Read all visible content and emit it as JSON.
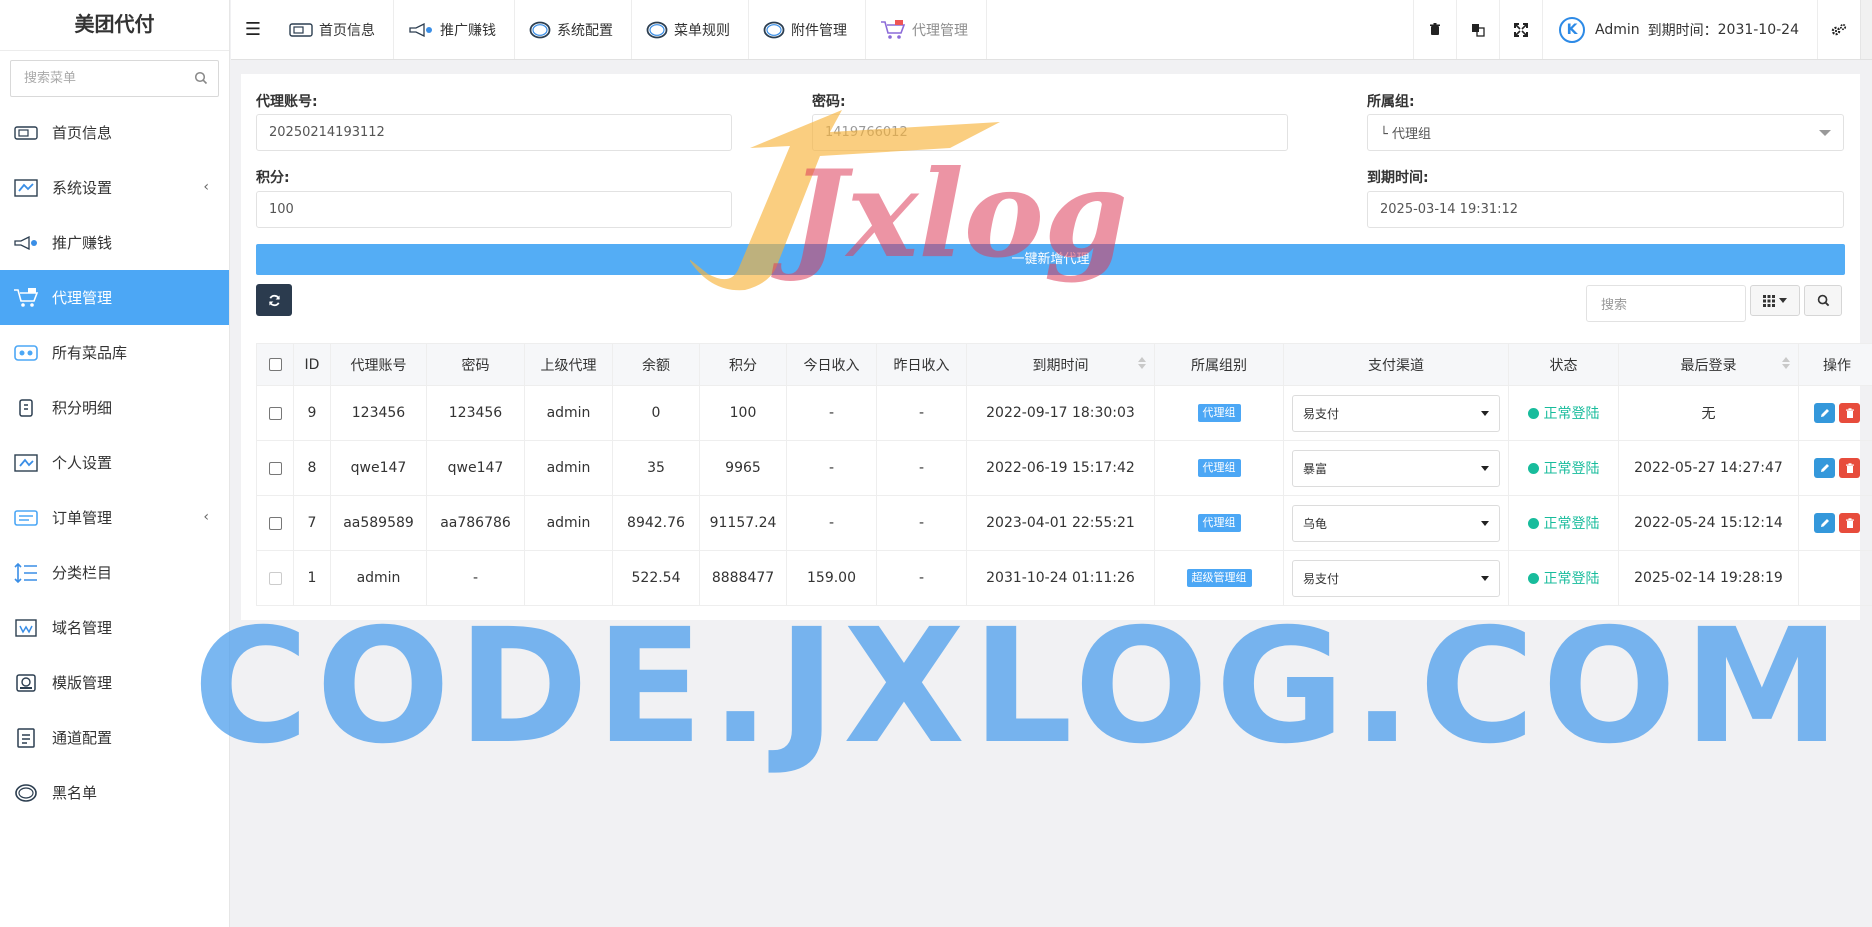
{
  "app": {
    "brand": "美团代付"
  },
  "sidebar": {
    "search_placeholder": "搜索菜单",
    "items": [
      {
        "label": "首页信息",
        "icon": "monitor-icon",
        "active": false,
        "has_children": false
      },
      {
        "label": "系统设置",
        "icon": "settings-panel-icon",
        "active": false,
        "has_children": true
      },
      {
        "label": "推广赚钱",
        "icon": "promo-icon",
        "active": false,
        "has_children": false
      },
      {
        "label": "代理管理",
        "icon": "cart-icon",
        "active": true,
        "has_children": false
      },
      {
        "label": "所有菜品库",
        "icon": "dish-icon",
        "active": false,
        "has_children": false
      },
      {
        "label": "积分明细",
        "icon": "points-icon",
        "active": false,
        "has_children": false
      },
      {
        "label": "个人设置",
        "icon": "user-settings-icon",
        "active": false,
        "has_children": false
      },
      {
        "label": "订单管理",
        "icon": "order-icon",
        "active": false,
        "has_children": true
      },
      {
        "label": "分类栏目",
        "icon": "category-icon",
        "active": false,
        "has_children": false
      },
      {
        "label": "域名管理",
        "icon": "domain-icon",
        "active": false,
        "has_children": false
      },
      {
        "label": "模版管理",
        "icon": "template-icon",
        "active": false,
        "has_children": false
      },
      {
        "label": "通道配置",
        "icon": "channel-icon",
        "active": false,
        "has_children": false
      },
      {
        "label": "黑名单",
        "icon": "blacklist-icon",
        "active": false,
        "has_children": false
      }
    ]
  },
  "topnav": {
    "tabs": [
      {
        "label": "首页信息",
        "icon": "monitor-icon"
      },
      {
        "label": "推广赚钱",
        "icon": "promo-icon"
      },
      {
        "label": "系统配置",
        "icon": "ring-icon"
      },
      {
        "label": "菜单规则",
        "icon": "ring-icon"
      },
      {
        "label": "附件管理",
        "icon": "ring-icon"
      },
      {
        "label": "代理管理",
        "icon": "cart-icon"
      }
    ],
    "user": {
      "name": "Admin",
      "expiry_label": "到期时间：",
      "expiry": "2031-10-24",
      "avatar_letter": "K"
    }
  },
  "form": {
    "account_label": "代理账号:",
    "account_value": "20250214193112",
    "password_label": "密码:",
    "password_value": "1419766012",
    "group_label": "所属组:",
    "group_value": "└ 代理组",
    "points_label": "积分:",
    "points_value": "100",
    "expiry_label": "到期时间:",
    "expiry_value": "2025-03-14 19:31:12",
    "add_button": "一键新增代理"
  },
  "toolbar": {
    "search_placeholder": "搜索"
  },
  "table": {
    "headers": [
      "ID",
      "代理账号",
      "密码",
      "上级代理",
      "余额",
      "积分",
      "今日收入",
      "昨日收入",
      "到期时间",
      "所属组别",
      "支付渠道",
      "状态",
      "最后登录",
      "操作"
    ],
    "rows": [
      {
        "id": "9",
        "account": "123456",
        "password": "123456",
        "parent": "admin",
        "balance": "0",
        "points": "100",
        "today": "-",
        "yesterday": "-",
        "expiry": "2022-09-17 18:30:03",
        "group": "代理组",
        "channel": "易支付",
        "status": "正常登陆",
        "last_login": "无",
        "ops": true
      },
      {
        "id": "8",
        "account": "qwe147",
        "password": "qwe147",
        "parent": "admin",
        "balance": "35",
        "points": "9965",
        "today": "-",
        "yesterday": "-",
        "expiry": "2022-06-19 15:17:42",
        "group": "代理组",
        "channel": "暴富",
        "status": "正常登陆",
        "last_login": "2022-05-27 14:27:47",
        "ops": true
      },
      {
        "id": "7",
        "account": "aa589589",
        "password": "aa786786",
        "parent": "admin",
        "balance": "8942.76",
        "points": "91157.24",
        "today": "-",
        "yesterday": "-",
        "expiry": "2023-04-01 22:55:21",
        "group": "代理组",
        "channel": "乌龟",
        "status": "正常登陆",
        "last_login": "2022-05-24 15:12:14",
        "ops": true
      },
      {
        "id": "1",
        "account": "admin",
        "password": "-",
        "parent": "",
        "balance": "522.54",
        "points": "8888477",
        "today": "159.00",
        "yesterday": "-",
        "expiry": "2031-10-24 01:11:26",
        "group": "超级管理组",
        "channel": "易支付",
        "status": "正常登陆",
        "last_login": "2025-02-14 19:28:19",
        "ops": false
      }
    ]
  },
  "watermark": {
    "logo_text": "Jxlog",
    "domain_text": "CODE.JXLOG.COM"
  },
  "colors": {
    "accent": "#4ca7f5",
    "status_ok": "#18bc9c",
    "edit": "#3498db",
    "delete": "#e74c3c",
    "dark_button": "#2b3b4e"
  }
}
